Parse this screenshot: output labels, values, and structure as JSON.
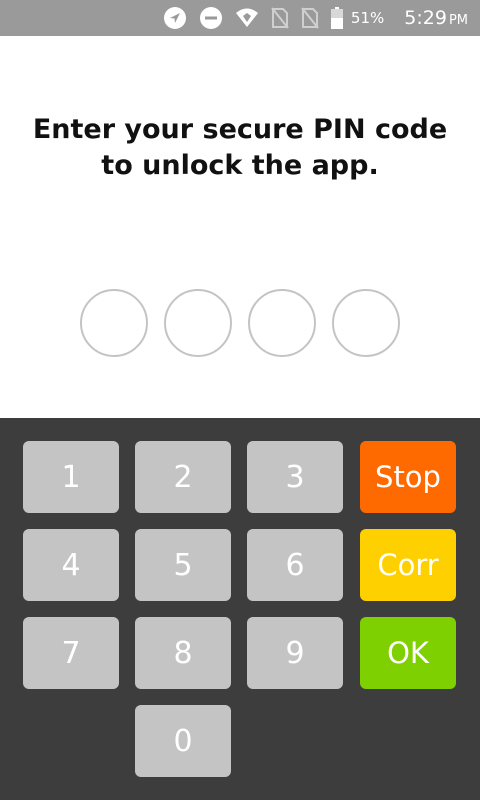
{
  "status_bar": {
    "battery_percent": "51%",
    "time": "5:29",
    "ampm": "PM",
    "icons": [
      "location-arrow-icon",
      "do-not-disturb-icon",
      "wifi-icon",
      "no-sim-icon",
      "no-sim-icon",
      "battery-icon"
    ]
  },
  "prompt": {
    "text": "Enter your secure PIN code to unlock the app."
  },
  "pin": {
    "length": 4,
    "entered": 0
  },
  "keypad": {
    "keys": [
      "1",
      "2",
      "3",
      "4",
      "5",
      "6",
      "7",
      "8",
      "9",
      "0"
    ],
    "stop_label": "Stop",
    "corr_label": "Corr",
    "ok_label": "OK"
  },
  "colors": {
    "status_bar": "#9a9a9a",
    "keypad_background": "#3d3d3d",
    "key_gray": "#c4c4c4",
    "stop": "#ff6a00",
    "corr": "#ffd000",
    "ok": "#7fd000"
  }
}
